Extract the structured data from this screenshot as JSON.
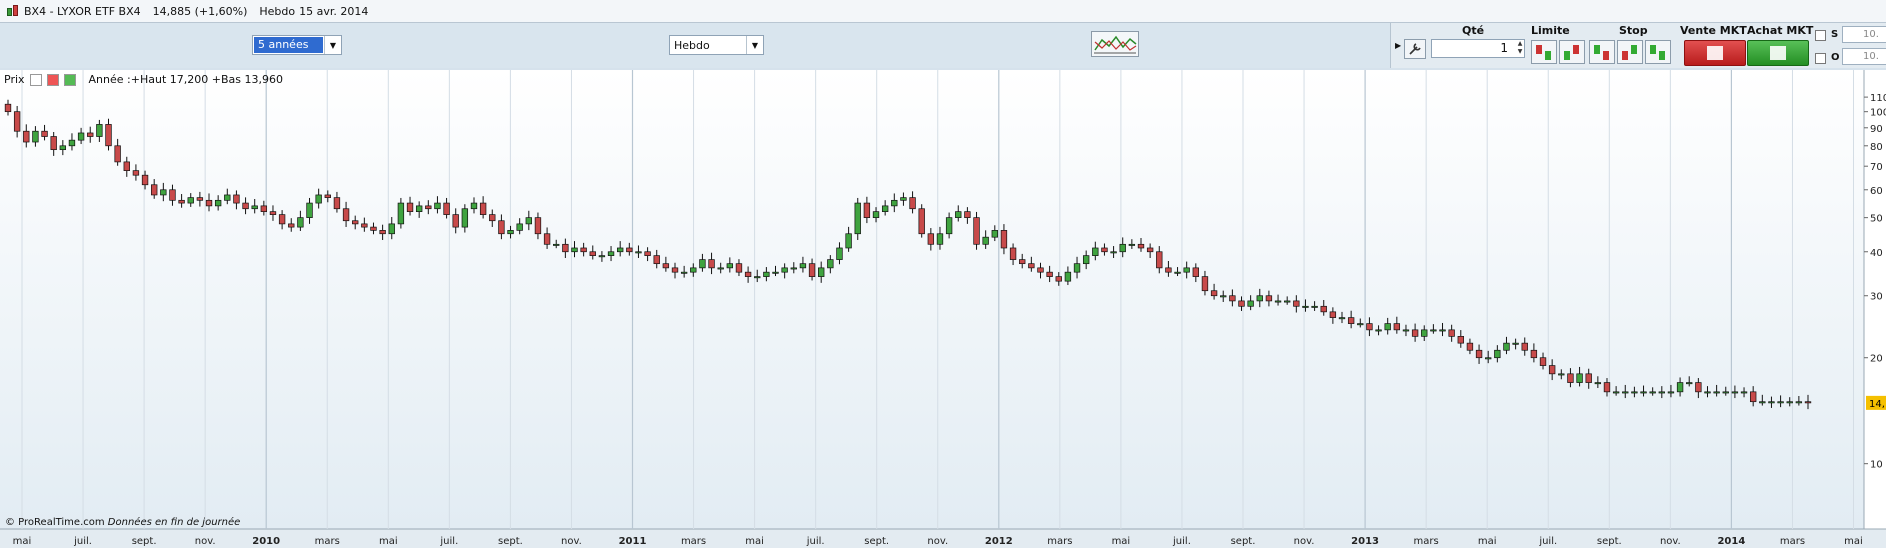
{
  "titlebar": {
    "symbol": "BX4 - LYXOR ETF BX4",
    "quote": "14,885 (+1,60%)",
    "period": "Hebdo",
    "date": "15 avr. 2014"
  },
  "toolbar": {
    "range_select": "5 années",
    "interval_select": "Hebdo"
  },
  "trade": {
    "qty_label": "Qté",
    "qty_value": "1",
    "limit_label": "Limite",
    "stop_label": "Stop",
    "sell_label": "Vente MKT",
    "buy_label": "Achat MKT",
    "s_label": "S",
    "o_label": "O",
    "s_value": "10.",
    "o_value": "10."
  },
  "legend": {
    "label": "Prix",
    "info": "Année :+Haut 17,200 +Bas 13,960"
  },
  "footer": {
    "credit": "© ProRealTime.com",
    "note": "Données en fin de journée"
  },
  "colors": {
    "up": "#3fa33f",
    "down": "#c84a4a",
    "last_price_bg": "#f5c000"
  },
  "chart_data": {
    "type": "candlestick",
    "y_scale": "log",
    "y_ticks": [
      10,
      20,
      30,
      40,
      50,
      60,
      70,
      80,
      90,
      100,
      110
    ],
    "y_tick_labels": [
      "10",
      "20",
      "30",
      "40",
      "50",
      "60",
      "70",
      "80",
      "90",
      "100",
      "110"
    ],
    "last_price_label": "14,",
    "x_labels": [
      "mai",
      "juil.",
      "sept.",
      "nov.",
      "2010",
      "mars",
      "mai",
      "juil.",
      "sept.",
      "nov.",
      "2011",
      "mars",
      "mai",
      "juil.",
      "sept.",
      "nov.",
      "2012",
      "mars",
      "mai",
      "juil.",
      "sept.",
      "nov.",
      "2013",
      "mars",
      "mai",
      "juil.",
      "sept.",
      "nov.",
      "2014",
      "mars",
      "mai"
    ],
    "x_label_bold": [
      false,
      false,
      false,
      false,
      true,
      false,
      false,
      false,
      false,
      false,
      true,
      false,
      false,
      false,
      false,
      false,
      true,
      false,
      false,
      false,
      false,
      false,
      true,
      false,
      false,
      false,
      false,
      false,
      true,
      false,
      false
    ],
    "ohlc_period": "weekly",
    "closes": [
      100,
      88,
      82,
      88,
      85,
      78,
      80,
      83,
      87,
      85,
      92,
      80,
      72,
      68,
      66,
      62,
      58,
      60,
      56,
      55,
      57,
      56,
      54,
      56,
      58,
      55,
      53,
      54,
      52,
      51,
      48,
      47,
      50,
      55,
      58,
      57,
      53,
      49,
      48,
      47,
      46,
      45,
      48,
      55,
      52,
      54,
      53,
      55,
      51,
      47,
      53,
      55,
      51,
      49,
      45,
      46,
      48,
      50,
      45,
      42,
      42,
      40,
      41,
      40,
      39,
      39,
      40,
      41,
      40,
      40,
      39,
      37,
      36,
      35,
      35,
      36,
      38,
      36,
      36,
      37,
      35,
      34,
      34,
      35,
      35,
      36,
      36,
      37,
      34,
      36,
      38,
      41,
      45,
      55,
      50,
      52,
      54,
      56,
      57,
      53,
      45,
      42,
      45,
      50,
      52,
      50,
      42,
      44,
      46,
      41,
      38,
      37,
      36,
      35,
      34,
      33,
      35,
      37,
      39,
      41,
      40,
      40,
      42,
      42,
      41,
      40,
      36,
      35,
      35,
      36,
      34,
      31,
      30,
      30,
      29,
      28,
      29,
      30,
      29,
      29,
      29,
      28,
      28,
      28,
      27,
      26,
      26,
      25,
      25,
      24,
      24,
      25,
      24,
      24,
      23,
      24,
      24,
      24,
      23,
      22,
      21,
      20,
      20,
      21,
      22,
      22,
      21,
      20,
      19,
      18,
      18,
      17,
      18,
      17,
      17,
      16,
      16,
      16,
      16,
      16,
      16,
      16,
      16,
      17,
      17,
      16,
      16,
      16,
      16,
      16,
      16,
      15,
      15,
      15,
      15,
      15,
      15,
      14.885
    ]
  }
}
